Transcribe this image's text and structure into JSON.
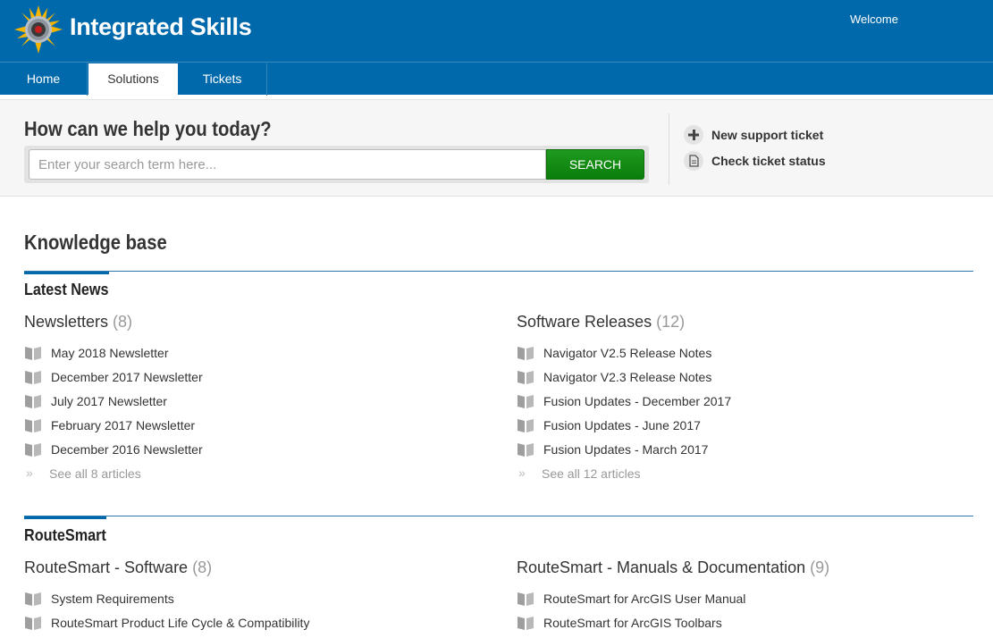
{
  "header": {
    "brand": "Integrated Skills",
    "welcome": "Welcome",
    "logo_icon": "sunflower-gear-logo"
  },
  "nav": {
    "tabs": [
      {
        "label": "Home",
        "active": false
      },
      {
        "label": "Solutions",
        "active": true
      },
      {
        "label": "Tickets",
        "active": false
      }
    ]
  },
  "help": {
    "title": "How can we help you today?",
    "search_placeholder": "Enter your search term here...",
    "search_value": "",
    "search_button": "SEARCH",
    "actions": [
      {
        "label": "New support ticket",
        "icon": "plus-icon"
      },
      {
        "label": "Check ticket status",
        "icon": "document-icon"
      }
    ]
  },
  "knowledge_base": {
    "title": "Knowledge base",
    "sections": [
      {
        "title": "Latest News",
        "categories": [
          {
            "name": "Newsletters",
            "count": "(8)",
            "articles": [
              "May 2018 Newsletter",
              "December 2017 Newsletter",
              "July 2017 Newsletter",
              "February 2017 Newsletter",
              "December 2016 Newsletter"
            ],
            "see_all": "See all 8 articles"
          },
          {
            "name": "Software Releases",
            "count": "(12)",
            "articles": [
              "Navigator V2.5 Release Notes",
              "Navigator V2.3 Release Notes",
              "Fusion Updates - December 2017",
              "Fusion Updates - June 2017",
              "Fusion Updates - March 2017"
            ],
            "see_all": "See all 12 articles"
          }
        ]
      },
      {
        "title": "RouteSmart",
        "categories": [
          {
            "name": "RouteSmart - Software",
            "count": "(8)",
            "articles": [
              "System Requirements",
              "RouteSmart Product Life Cycle & Compatibility"
            ]
          },
          {
            "name": "RouteSmart - Manuals & Documentation",
            "count": "(9)",
            "articles": [
              "RouteSmart for ArcGIS User Manual",
              "RouteSmart for ArcGIS Toolbars"
            ]
          }
        ]
      }
    ]
  },
  "colors": {
    "brand_blue": "#0069ab",
    "search_green": "#1f9a1f",
    "muted_gray": "#999999"
  }
}
